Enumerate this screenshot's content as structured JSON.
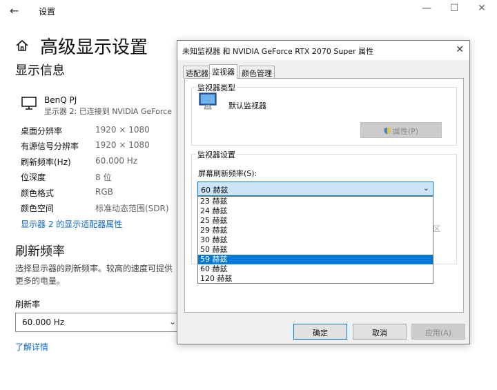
{
  "window": {
    "title": "设置"
  },
  "page": {
    "title": "高级显示设置"
  },
  "display_info": {
    "heading": "显示信息",
    "display_name": "BenQ PJ",
    "display_sub": "显示器 2: 已连接到 NVIDIA GeForce",
    "rows": [
      {
        "label": "桌面分辨率",
        "value": "1920 × 1080"
      },
      {
        "label": "有源信号分辨率",
        "value": "1920 × 1080"
      },
      {
        "label": "刷新频率(Hz)",
        "value": "60.000 Hz"
      },
      {
        "label": "位深度",
        "value": "8 位"
      },
      {
        "label": "颜色格式",
        "value": "RGB"
      },
      {
        "label": "颜色空间",
        "value": "标准动态范围(SDR)"
      }
    ],
    "adapter_link": "显示器 2 的显示适配器属性"
  },
  "refresh": {
    "heading": "刷新频率",
    "desc_line1": "选择显示器的刷新频率。较高的速度可提供",
    "desc_line2": "更多的电量。",
    "label": "刷新率",
    "value": "60.000 Hz",
    "learn_more": "了解详情"
  },
  "dialog": {
    "title": "未知监视器 和 NVIDIA GeForce RTX 2070 Super 属性",
    "tabs": [
      "适配器",
      "监视器",
      "颜色管理"
    ],
    "active_tab": "监视器",
    "monitor_type_group": "监视器类型",
    "monitor_name": "默认监视器",
    "properties_button": "属性(P)",
    "monitor_settings_group": "监视器设置",
    "rate_label": "屏幕刷新频率(S):",
    "rate_value": "60 赫兹",
    "rate_options": [
      "23 赫兹",
      "24 赫兹",
      "25 赫兹",
      "29 赫兹",
      "30 赫兹",
      "50 赫兹",
      "59 赫兹",
      "60 赫兹",
      "120 赫兹"
    ],
    "highlighted_option": "59 赫兹",
    "hidden_fragment": "区",
    "ok": "确定",
    "cancel": "取消",
    "apply": "应用(A)"
  }
}
